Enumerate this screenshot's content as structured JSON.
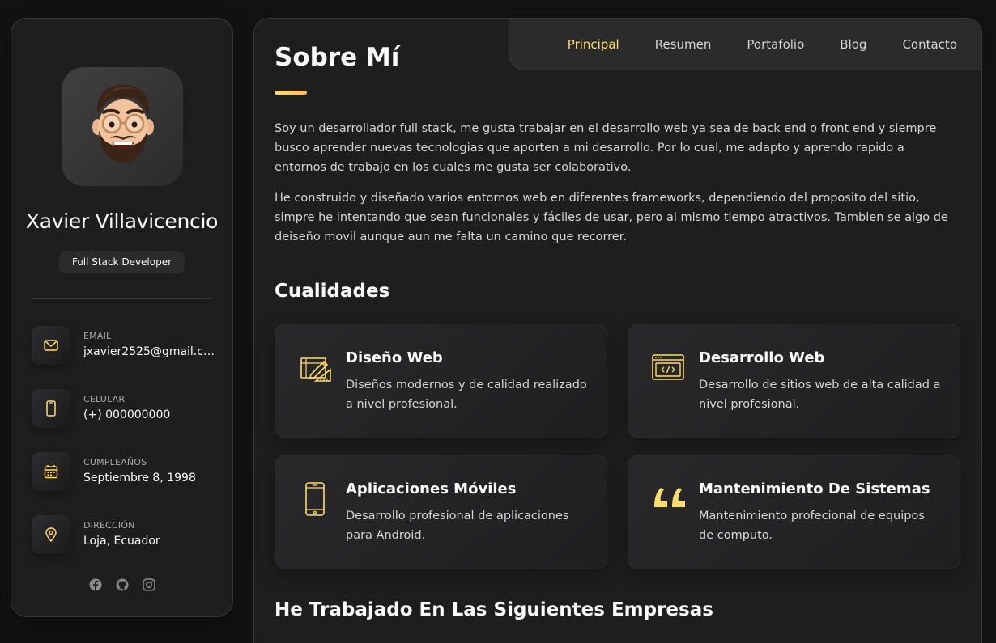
{
  "colors": {
    "accent": "#ffdb70",
    "background": "#121212",
    "panel": "#1e1e1f",
    "border": "#383838"
  },
  "profile": {
    "name": "Xavier Villavicencio",
    "title": "Full Stack Developer",
    "avatar_icon": "memoji-avatar"
  },
  "contacts": [
    {
      "icon": "mail-icon",
      "label": "Email",
      "value": "jxavier2525@gmail.co..."
    },
    {
      "icon": "phone-icon",
      "label": "Celular",
      "value": "(+) 000000000"
    },
    {
      "icon": "calendar-icon",
      "label": "Cumpleaños",
      "value": "Septiembre 8, 1998"
    },
    {
      "icon": "location-pin-icon",
      "label": "Dirección",
      "value": "Loja, Ecuador"
    }
  ],
  "socials": [
    "facebook-icon",
    "github-icon",
    "instagram-icon"
  ],
  "nav": {
    "items": [
      "Principal",
      "Resumen",
      "Portafolio",
      "Blog",
      "Contacto"
    ],
    "active": "Principal"
  },
  "main": {
    "title": "Sobre Mí",
    "paragraphs": [
      "Soy un desarrollador full stack, me gusta trabajar en el desarrollo web ya sea de back end o front end y siempre busco aprender nuevas tecnologias que aporten a mi desarrollo. Por lo cual, me adapto y aprendo rapido a entornos de trabajo en los cuales me gusta ser colaborativo.",
      "He construido y diseñado varios entornos web en diferentes frameworks, dependiendo del proposito del sitio, simpre he intentando que sean funcionales y fáciles de usar, pero al mismo tiempo atractivos. Tambien se algo de deiseño movil aunque aun me falta un camino que recorrer."
    ],
    "qualities_title": "Cualidades",
    "qualities": [
      {
        "icon": "design-tools-icon",
        "title": "Diseño Web",
        "text": "Diseños modernos y de calidad realizado a nivel profesional."
      },
      {
        "icon": "code-window-icon",
        "title": "Desarrollo Web",
        "text": "Desarrollo de sitios web de alta calidad a nivel profesional."
      },
      {
        "icon": "smartphone-icon",
        "title": "Aplicaciones Móviles",
        "text": "Desarrollo profesional de aplicaciones para Android."
      },
      {
        "icon": "quote-icon",
        "title": "Mantenimiento De Sistemas",
        "text": "Mantenimiento profecional de equipos de computo."
      }
    ],
    "companies_title": "He Trabajado En Las Siguientes Empresas"
  }
}
